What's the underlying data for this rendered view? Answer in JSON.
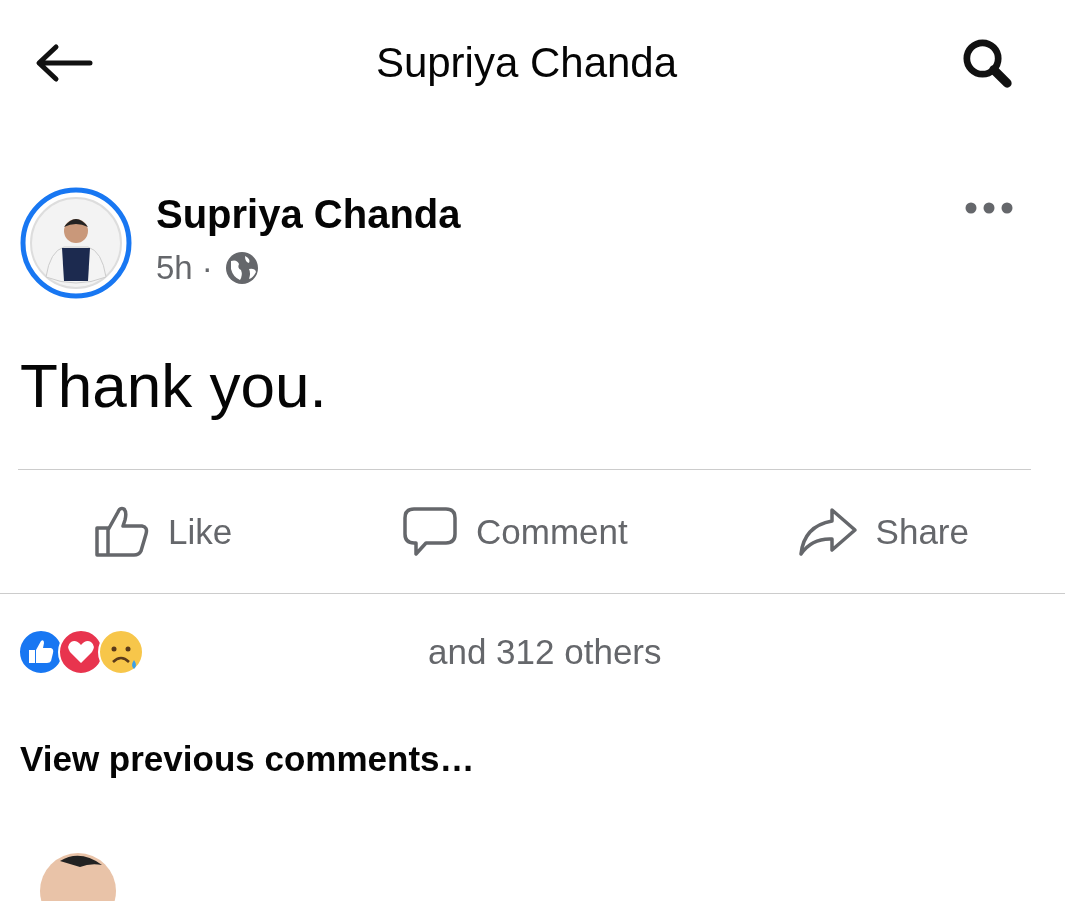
{
  "header": {
    "title": "Supriya Chanda"
  },
  "post": {
    "author": "Supriya Chanda",
    "time": "5h ·",
    "public": true,
    "text": "Thank you."
  },
  "actions": [
    {
      "kind": "like",
      "label": "Like"
    },
    {
      "kind": "comment",
      "label": "Comment"
    },
    {
      "kind": "share",
      "label": "Share"
    }
  ],
  "reactions": {
    "icons": [
      {
        "kind": "like"
      },
      {
        "kind": "love"
      },
      {
        "kind": "sad"
      }
    ],
    "summary": "and 312 others"
  },
  "comments": {
    "view_previous": "View previous comments…"
  }
}
